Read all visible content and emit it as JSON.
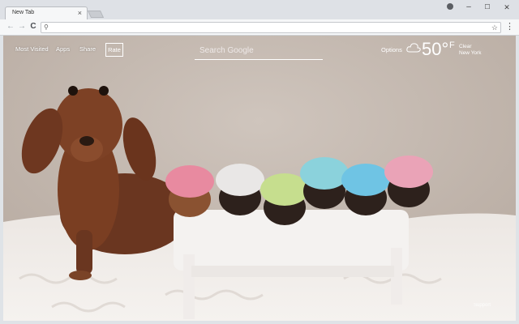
{
  "browser": {
    "tab_title": "New Tab",
    "tab_close": "×",
    "window_controls": {
      "minimize": "–",
      "maximize": "☐",
      "close": "✕"
    },
    "nav": {
      "back": "←",
      "forward": "→",
      "reload": "C"
    },
    "omnibox": {
      "search_icon": "⚲",
      "value": "",
      "star": "☆"
    },
    "menu": "⋮"
  },
  "page": {
    "nav_links": [
      "Most Visited",
      "Apps",
      "Share"
    ],
    "rate_label": "Rate",
    "search_placeholder": "Search Google",
    "options_label": "Options",
    "weather": {
      "temperature": "50°",
      "unit": "F",
      "condition": "Clear",
      "location": "New York"
    },
    "support_label": "Support",
    "background": {
      "hat_colors": [
        "#e88aa0",
        "#e9e7e6",
        "#c6de8e",
        "#8bd2dc",
        "#6fc4e4",
        "#eaa3b7"
      ]
    }
  }
}
